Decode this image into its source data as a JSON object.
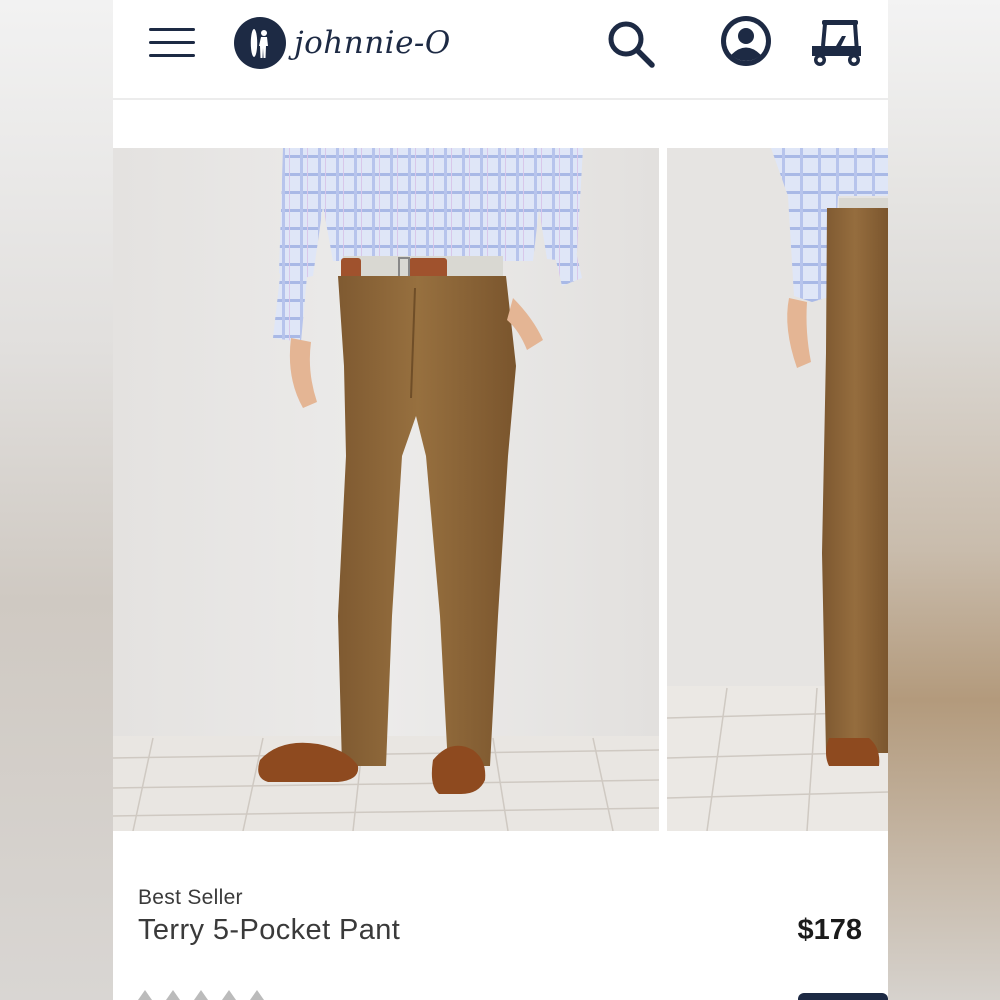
{
  "brand": {
    "name": "johnnie-O"
  },
  "header": {
    "icons": [
      "menu-icon",
      "search-icon",
      "account-icon",
      "golf-cart-icon"
    ]
  },
  "gallery": {
    "images": [
      "product-photo-front",
      "product-photo-side"
    ]
  },
  "product": {
    "badge": "Best Seller",
    "name": "Terry 5-Pocket Pant",
    "price": "$178"
  },
  "colors": {
    "brand_navy": "#1d2a44",
    "text_gray": "#3a3a3a",
    "pant_brown": "#8f6638"
  }
}
